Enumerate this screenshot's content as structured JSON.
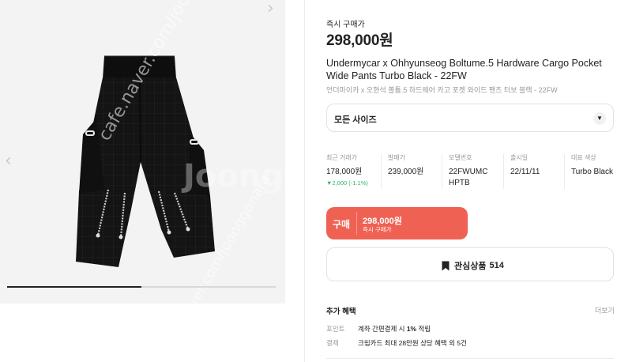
{
  "gallery": {
    "watermark_url": "cafe.naver.com/joonggonara",
    "watermark_logo": "Joong",
    "prev_arrow": "‹",
    "next_arrow": "›",
    "progress": 0.5
  },
  "product": {
    "buy_now_label": "즉시 구매가",
    "price": "298,000원",
    "title_en": "Undermycar x Ohhyunseog Boltume.5 Hardware Cargo Pocket Wide Pants Turbo Black - 22FW",
    "title_ko": "언더마이카 x 오현석 볼튬.5 하드웨어 카고 포켓 와이드 팬츠 터보 블랙 - 22FW"
  },
  "size_select": {
    "label": "모든 사이즈",
    "icon": "chevron-down-icon"
  },
  "stats": [
    {
      "key": "최근 거래가",
      "value": "178,000원",
      "change": "▼2,000 (-1.1%)"
    },
    {
      "key": "발매가",
      "value": "239,000원"
    },
    {
      "key": "모델번호",
      "value": "22FWUMC HPTB"
    },
    {
      "key": "출시일",
      "value": "22/11/11"
    },
    {
      "key": "대표 색상",
      "value": "Turbo Black"
    }
  ],
  "buy_button": {
    "label": "구매",
    "price": "298,000원",
    "sub": "즉시 구매가"
  },
  "wish_button": {
    "label": "관심상품",
    "count": "514",
    "icon": "bookmark-icon"
  },
  "benefits": {
    "title": "추가 혜택",
    "more": "더보기",
    "rows": [
      {
        "key": "포인트",
        "text_pre": "계좌 간편결제 시 ",
        "highlight": "1%",
        "text_post": " 적립"
      },
      {
        "key": "결제",
        "text_pre": "크림카드 최대 28만원 상당 혜택 외 5건",
        "highlight": "",
        "text_post": ""
      }
    ]
  },
  "colors": {
    "buy_red": "#ef6253",
    "price_drop_green": "#31b46e",
    "gallery_bg": "#f3f3f3"
  }
}
